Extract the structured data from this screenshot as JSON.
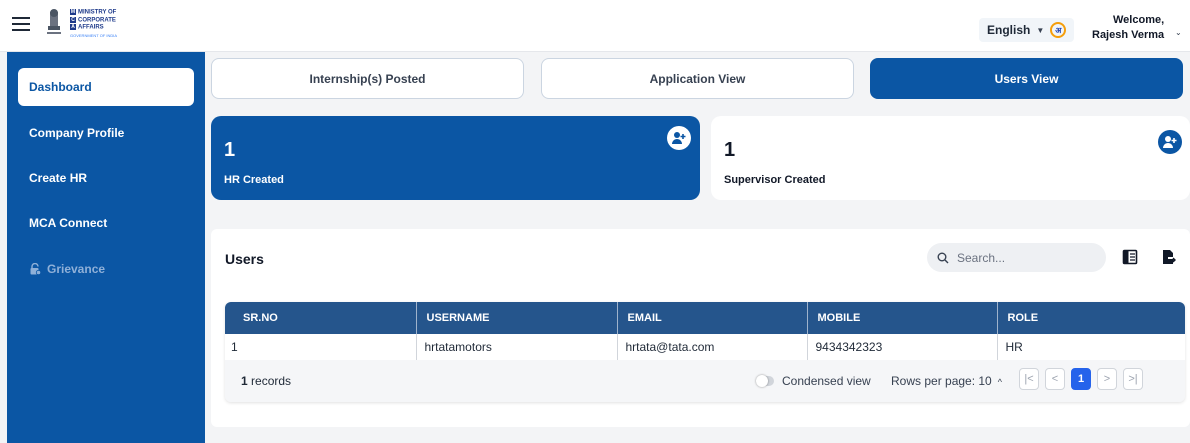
{
  "header": {
    "logo_lines": [
      "MINISTRY OF",
      "CORPORATE",
      "AFFAIRS"
    ],
    "logo_letters": [
      "M",
      "C",
      "A"
    ],
    "logo_sub": "GOVERNMENT OF INDIA",
    "language": "English",
    "language_icon_glyph": "अ",
    "welcome_line": "Welcome,",
    "user_name": "Rajesh Verma"
  },
  "sidebar": {
    "items": [
      {
        "label": "Dashboard",
        "active": true
      },
      {
        "label": "Company Profile"
      },
      {
        "label": "Create HR"
      },
      {
        "label": "MCA Connect"
      },
      {
        "label": "Grievance",
        "disabled": true,
        "icon": "lock-icon"
      }
    ]
  },
  "tabs": [
    {
      "label": "Internship(s) Posted"
    },
    {
      "label": "Application View"
    },
    {
      "label": "Users View",
      "active": true
    }
  ],
  "stats": [
    {
      "value": "1",
      "label": "HR Created",
      "icon": "add-user-icon"
    },
    {
      "value": "1",
      "label": "Supervisor Created",
      "icon": "add-user-icon"
    }
  ],
  "users": {
    "title": "Users",
    "search_placeholder": "Search...",
    "columns": [
      "SR.NO",
      "USERNAME",
      "EMAIL",
      "MOBILE",
      "ROLE"
    ],
    "rows": [
      [
        "1",
        "hrtatamotors",
        "hrtata@tata.com",
        "9434342323",
        "HR"
      ]
    ],
    "records_count": "1",
    "records_label": "records",
    "condensed_label": "Condensed view",
    "rows_per_page_label": "Rows per page: 10",
    "current_page": "1"
  },
  "colors": {
    "primary": "#0b56a4",
    "table_header": "#25558c",
    "page_active": "#2563eb"
  }
}
